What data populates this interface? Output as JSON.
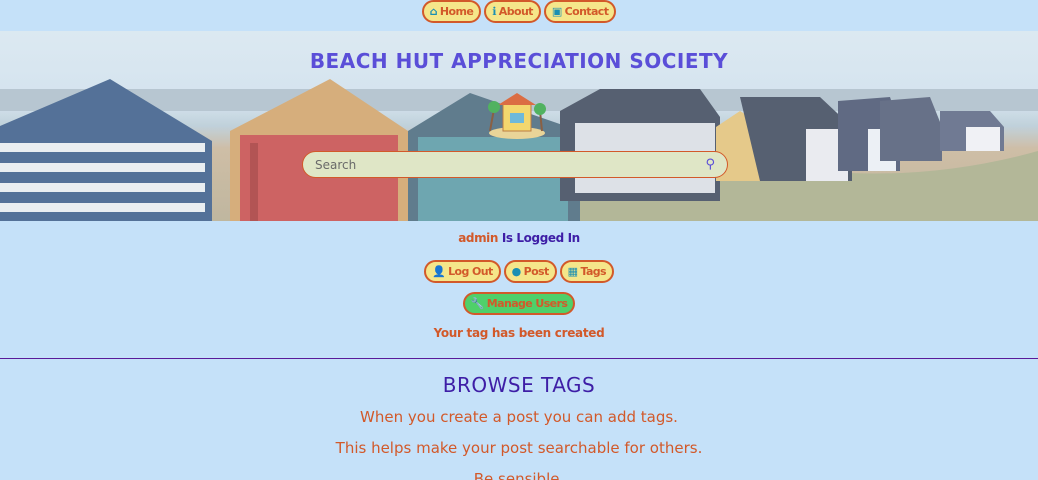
{
  "nav": {
    "home": "Home",
    "about": "About",
    "contact": "Contact"
  },
  "hero": {
    "title": "BEACH HUT APPRECIATION SOCIETY"
  },
  "search": {
    "placeholder": "Search"
  },
  "session": {
    "username": "admin",
    "status_text": "Is Logged In"
  },
  "actions": {
    "logout": "Log Out",
    "post": "Post",
    "tags": "Tags",
    "manage_users": "Manage Users"
  },
  "flash": "Your tag has been created",
  "browse": {
    "title": "BROWSE TAGS",
    "lines": [
      "When you create a post you can add tags.",
      "This helps make your post searchable for others.",
      "Be sensible."
    ]
  },
  "colors": {
    "background": "#c5e1f9",
    "accent_orange": "#d2592a",
    "pill_yellow": "#f5e68a",
    "heading_purple": "#3e1ea6"
  }
}
